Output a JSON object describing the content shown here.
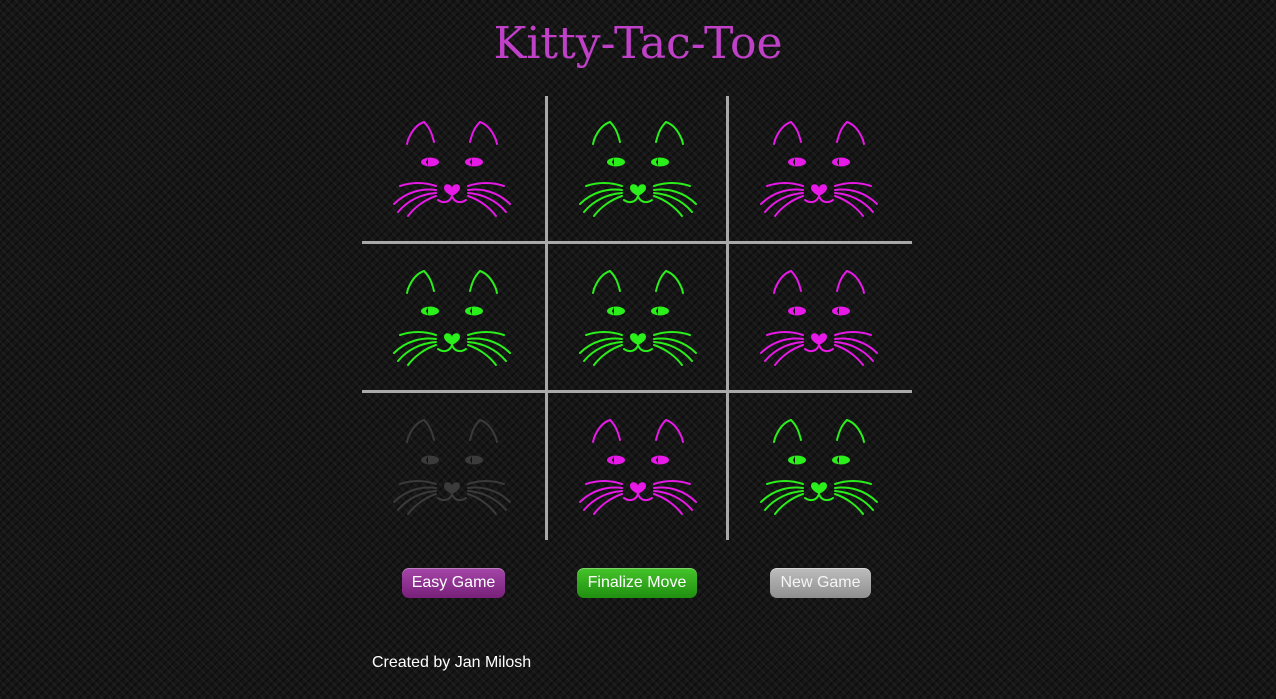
{
  "title": "Kitty-Tac-Toe",
  "colors": {
    "magenta": "#e619e6",
    "green": "#2bef1a",
    "ghost": "#3a3a3a",
    "grid": "#a9a9a9",
    "title": "#c040c8"
  },
  "board": {
    "cells": [
      {
        "pos": "top-left",
        "player": "magenta"
      },
      {
        "pos": "top-center",
        "player": "green"
      },
      {
        "pos": "top-right",
        "player": "magenta"
      },
      {
        "pos": "middle-left",
        "player": "green"
      },
      {
        "pos": "center",
        "player": "green"
      },
      {
        "pos": "middle-right",
        "player": "magenta"
      },
      {
        "pos": "bottom-left",
        "player": "ghost"
      },
      {
        "pos": "bottom-center",
        "player": "magenta"
      },
      {
        "pos": "bottom-right",
        "player": "green"
      }
    ]
  },
  "buttons": {
    "easy": "Easy Game",
    "finalize": "Finalize Move",
    "new_game": "New Game"
  },
  "footer": {
    "credit": "Created by Jan Milosh"
  }
}
